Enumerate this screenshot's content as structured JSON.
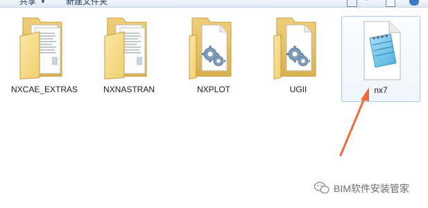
{
  "toolbar": {
    "share_label": "共享",
    "new_folder_label": "新建文件夹",
    "icons": [
      "chevron-down-icon",
      "view-options-icon",
      "preview-pane-icon",
      "help-icon"
    ]
  },
  "files": [
    {
      "name": "NXCAE_EXTRAS",
      "type": "folder-with-documents",
      "selected": false
    },
    {
      "name": "NXNASTRAN",
      "type": "folder-with-documents",
      "selected": false
    },
    {
      "name": "NXPLOT",
      "type": "folder-with-gears",
      "selected": false
    },
    {
      "name": "UGII",
      "type": "folder-with-gears",
      "selected": false
    },
    {
      "name": "nx7",
      "type": "notepad-text-file",
      "selected": true
    }
  ],
  "annotation": {
    "type": "arrow",
    "color": "#f06a3c",
    "points_to": "nx7"
  },
  "watermark": {
    "text": "BIM软件安装管家",
    "icon": "wechat-icon"
  },
  "colors": {
    "folder_fill": "#f5d889",
    "folder_dark": "#d8b450",
    "selection_border": "#a8c7ea",
    "annotation": "#f06a3c"
  }
}
